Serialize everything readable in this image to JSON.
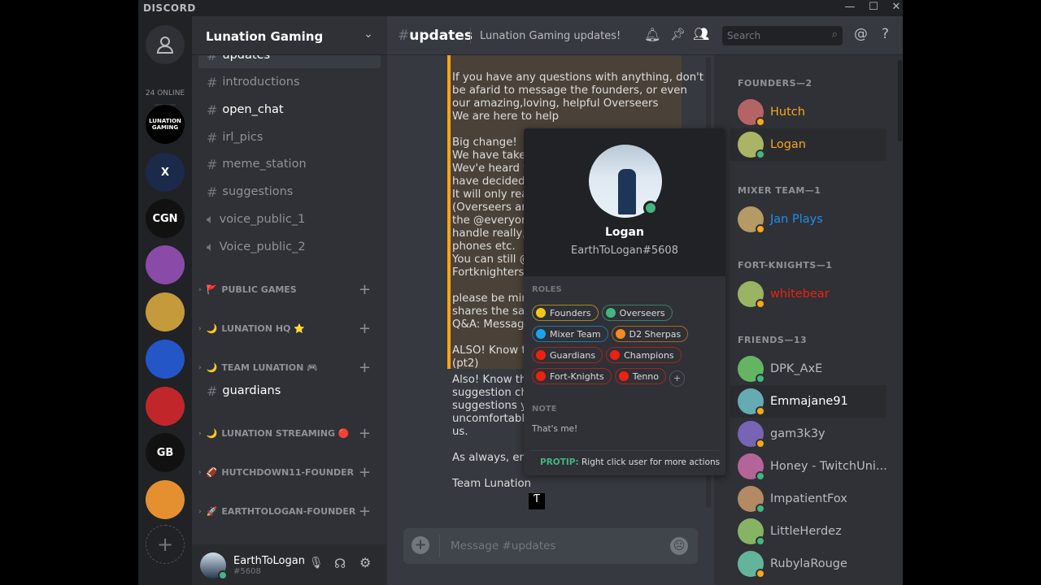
{
  "app": {
    "logo": "DISCORD",
    "minimize": "—",
    "maximize": "☐",
    "close": "✕"
  },
  "guilds": {
    "online": "24 ONLINE",
    "items": [
      {
        "label": "LUNATION GAMING",
        "color": "#000000"
      },
      {
        "label": "X",
        "color": "#1b2a4a"
      },
      {
        "label": "CGN",
        "color": "#111111"
      },
      {
        "label": "",
        "color": "#8a4aa8"
      },
      {
        "label": "",
        "color": "#c49a3a"
      },
      {
        "label": "",
        "color": "#2456c8"
      },
      {
        "label": "",
        "color": "#c0262a"
      },
      {
        "label": "GB",
        "color": "#111111"
      },
      {
        "label": "",
        "color": "#e49030"
      }
    ],
    "add": "+"
  },
  "server": {
    "name": "Lunation Gaming"
  },
  "channels": {
    "items": [
      {
        "name": "updates",
        "state": "selected"
      },
      {
        "name": "introductions",
        "state": "muted"
      },
      {
        "name": "open_chat",
        "state": "unread"
      },
      {
        "name": "irl_pics",
        "state": "muted"
      },
      {
        "name": "meme_station",
        "state": "muted"
      },
      {
        "name": "suggestions",
        "state": "muted"
      },
      {
        "name": "voice_public_1",
        "state": "voice"
      },
      {
        "name": "Voice_public_2",
        "state": "voice"
      }
    ],
    "categories": [
      {
        "emoji": "🚩",
        "name": "PUBLIC GAMES"
      },
      {
        "emoji": "🌙",
        "name": "LUNATION HQ ⭐"
      },
      {
        "emoji": "🌙",
        "name": "TEAM LUNATION 🎮"
      },
      {
        "emoji": "🌙",
        "name": "LUNATION STREAMING 🔴"
      },
      {
        "emoji": "🏈",
        "name": "HUTCHDOWN11-FOUNDER"
      },
      {
        "emoji": "🚀",
        "name": "EARTHTOLOGAN-FOUNDER"
      }
    ],
    "locked_channel": "guardians"
  },
  "user": {
    "name": "EarthToLogan",
    "tag": "#5608"
  },
  "header": {
    "channel": "updates",
    "topic": "Lunation Gaming updates!",
    "search_placeholder": "Search"
  },
  "messages": {
    "embed_lines": [
      "If you have any questions with anything, don't",
      "be afarid to message the founders, or even",
      "our amazing,loving, helpful Overseers",
      "We are here to help",
      "",
      "Big change!",
      "We have taker",
      "Wev'e heard y",
      "have decided t",
      "It will only rea",
      "(Overseers an",
      "the @everyone",
      "handle really, s",
      "phones etc.",
      "You can still @",
      "Fortknighters",
      "",
      "please be mind",
      "shares the san",
      "Q&A: Messag",
      "",
      "ALSO! Know t",
      "(pt2)"
    ],
    "after_lines": [
      "Also! Know th",
      "suggestion cha",
      "suggestions yo",
      "uncomfortable",
      "us.",
      "",
      "As always, enj",
      "",
      "Team Lunation"
    ],
    "composer_placeholder": "Message #updates"
  },
  "popout": {
    "name": "Logan",
    "tag": "EarthToLogan#5608",
    "roles_label": "ROLES",
    "roles": [
      {
        "name": "Founders",
        "color": "#f5c518"
      },
      {
        "name": "Overseers",
        "color": "#43b581"
      },
      {
        "name": "Mixer Team",
        "color": "#1da1f2"
      },
      {
        "name": "D2 Sherpas",
        "color": "#f58a1f"
      },
      {
        "name": "Guardians",
        "color": "#f0200f"
      },
      {
        "name": "Champions",
        "color": "#f0200f"
      },
      {
        "name": "Fort-Knights",
        "color": "#f0200f"
      },
      {
        "name": "Tenno",
        "color": "#f0200f"
      }
    ],
    "add_role": "+",
    "note_label": "NOTE",
    "note": "That's me!",
    "protip_label": "PROTIP:",
    "protip": "Right click user for more actions"
  },
  "members": {
    "groups": [
      {
        "title": "FOUNDERS—2",
        "members": [
          {
            "name": "Hutch",
            "color": "#faa61a",
            "status": "idle"
          },
          {
            "name": "Logan",
            "color": "#faa61a",
            "status": "online"
          }
        ]
      },
      {
        "title": "MIXER TEAM—1",
        "members": [
          {
            "name": "Jan Plays",
            "color": "#1e90e8",
            "status": "idle"
          }
        ]
      },
      {
        "title": "FORT-KNIGHTS—1",
        "members": [
          {
            "name": "whitebear",
            "color": "#f0200f",
            "status": "idle"
          }
        ]
      },
      {
        "title": "FRIENDS—13",
        "members": [
          {
            "name": "DPK_AxE",
            "color": "#b9bbbe",
            "status": "online"
          },
          {
            "name": "Emmajane91",
            "color": "#ffffff",
            "status": "idle"
          },
          {
            "name": "gam3k3y",
            "color": "#b9bbbe",
            "status": "idle"
          },
          {
            "name": "Honey - TwitchUni...",
            "color": "#b9bbbe",
            "status": "online"
          },
          {
            "name": "ImpatientFox",
            "color": "#b9bbbe",
            "status": "online"
          },
          {
            "name": "LittleHerdez",
            "color": "#b9bbbe",
            "status": "online"
          },
          {
            "name": "RubylaRouge",
            "color": "#b9bbbe",
            "status": "idle"
          }
        ]
      }
    ]
  },
  "status_colors": {
    "online": "#43b581",
    "idle": "#faa61a"
  }
}
